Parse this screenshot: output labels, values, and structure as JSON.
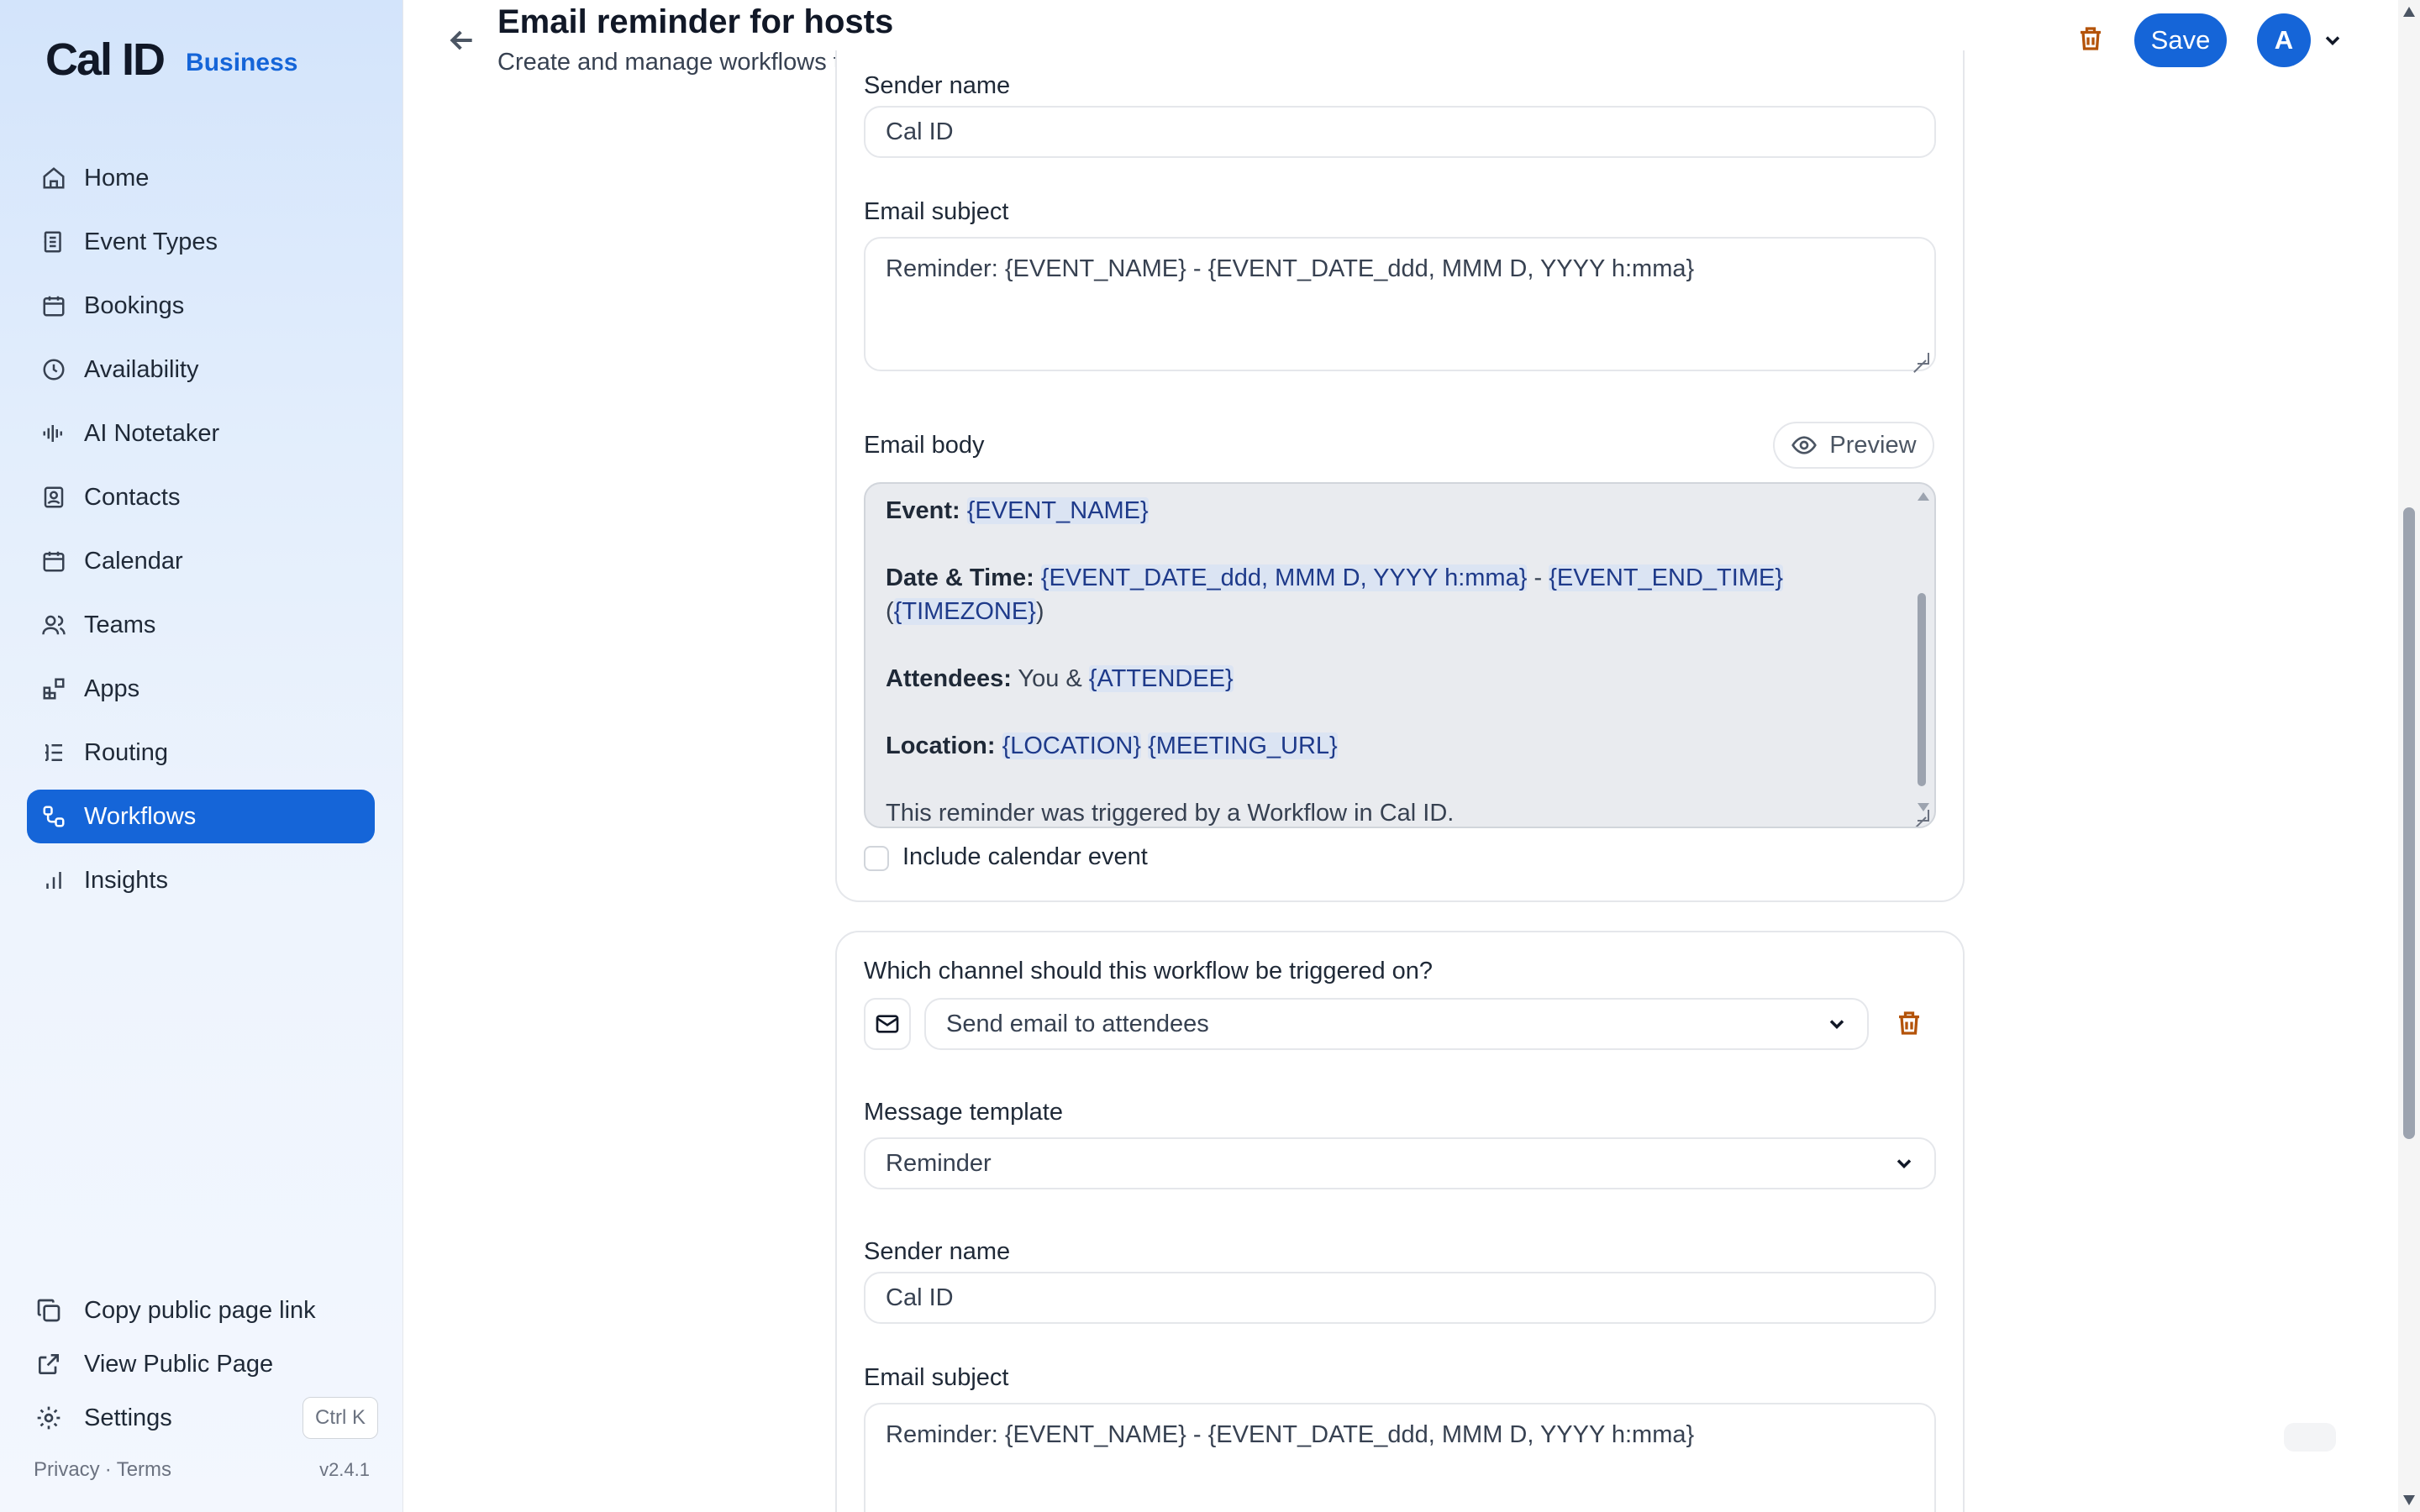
{
  "brand": {
    "name": "Cal ID",
    "plan": "Business",
    "accent": "#1565d8"
  },
  "sidebar": {
    "items": [
      {
        "label": "Home",
        "icon": "home-icon"
      },
      {
        "label": "Event Types",
        "icon": "event-types-icon"
      },
      {
        "label": "Bookings",
        "icon": "calendar-icon"
      },
      {
        "label": "Availability",
        "icon": "clock-icon"
      },
      {
        "label": "AI Notetaker",
        "icon": "waveform-icon"
      },
      {
        "label": "Contacts",
        "icon": "contacts-icon"
      },
      {
        "label": "Calendar",
        "icon": "calendar-icon"
      },
      {
        "label": "Teams",
        "icon": "users-icon"
      },
      {
        "label": "Apps",
        "icon": "apps-icon"
      },
      {
        "label": "Routing",
        "icon": "routing-icon"
      },
      {
        "label": "Workflows",
        "icon": "workflow-icon",
        "active": true
      },
      {
        "label": "Insights",
        "icon": "bar-chart-icon"
      }
    ],
    "bottom": {
      "copy_link": "Copy public page link",
      "view_public": "View Public Page",
      "settings": "Settings",
      "settings_shortcut": "Ctrl K"
    },
    "footer": {
      "privacy": "Privacy",
      "separator": "·",
      "terms": "Terms",
      "version": "v2.4.1"
    }
  },
  "header": {
    "title": "Email reminder for hosts",
    "subtitle": "Create and manage workflows to automate your event processes",
    "save_label": "Save",
    "avatar_initial": "A"
  },
  "step1": {
    "sender_name_label": "Sender name",
    "sender_name_value": "Cal ID",
    "email_subject_label": "Email subject",
    "email_subject_value": "Reminder: {EVENT_NAME} - {EVENT_DATE_ddd, MMM D, YYYY h:mma}",
    "email_body_label": "Email body",
    "preview_label": "Preview",
    "body": {
      "event_label": "Event:",
      "event_var": "{EVENT_NAME}",
      "datetime_label": "Date & Time:",
      "datetime_var1": "{EVENT_DATE_ddd, MMM D, YYYY h:mma}",
      "datetime_sep": " - ",
      "datetime_var2": "{EVENT_END_TIME}",
      "tz_open": "(",
      "tz_var": "{TIMEZONE}",
      "tz_close": ")",
      "attendees_label": "Attendees:",
      "attendees_text": " You & ",
      "attendees_var": "{ATTENDEE}",
      "location_label": "Location:",
      "location_var1": "{LOCATION}",
      "location_var2": "{MEETING_URL}",
      "footer_text": "This reminder was triggered by a Workflow in Cal ID."
    },
    "include_calendar_label": "Include calendar event"
  },
  "step2": {
    "channel_question": "Which channel should this workflow be triggered on?",
    "channel_value": "Send email to attendees",
    "template_label": "Message template",
    "template_value": "Reminder",
    "sender_name_label": "Sender name",
    "sender_name_value": "Cal ID",
    "email_subject_label": "Email subject",
    "email_subject_value": "Reminder: {EVENT_NAME} - {EVENT_DATE_ddd, MMM D, YYYY h:mma}"
  }
}
